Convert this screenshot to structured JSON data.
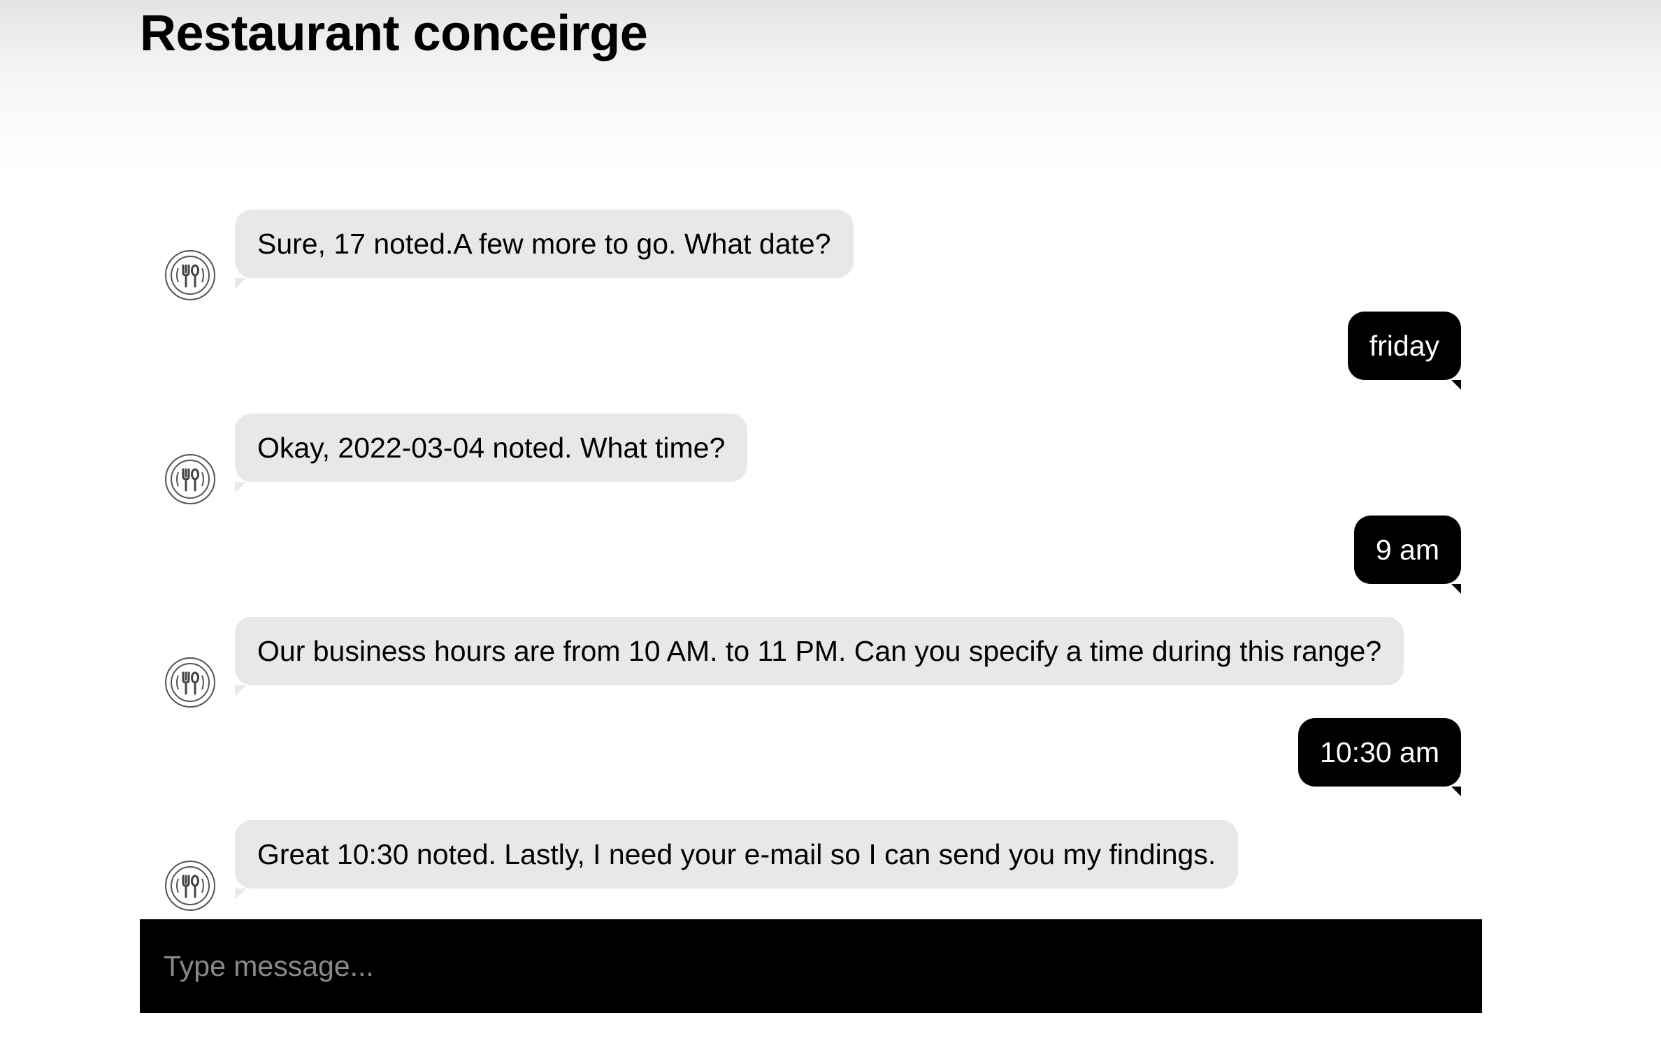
{
  "header": {
    "title": "Restaurant conceirge"
  },
  "conversation": {
    "messages": [
      {
        "sender": "bot",
        "text": "Sure, 17 noted.A few more to go. What date?"
      },
      {
        "sender": "user",
        "text": "friday"
      },
      {
        "sender": "bot",
        "text": "Okay, 2022-03-04 noted. What time?"
      },
      {
        "sender": "user",
        "text": "9 am"
      },
      {
        "sender": "bot",
        "text": "Our business hours are from 10 AM. to 11 PM. Can you specify a time during this range?"
      },
      {
        "sender": "user",
        "text": "10:30 am"
      },
      {
        "sender": "bot",
        "text": "Great 10:30 noted. Lastly, I need your e-mail so I can send you my findings."
      }
    ],
    "bot_avatar_icon": "fork-spoon-icon"
  },
  "composer": {
    "placeholder": "Type message...",
    "value": ""
  },
  "colors": {
    "bot_bubble": "#e8e8e8",
    "user_bubble": "#000000",
    "composer_bg": "#000000"
  }
}
